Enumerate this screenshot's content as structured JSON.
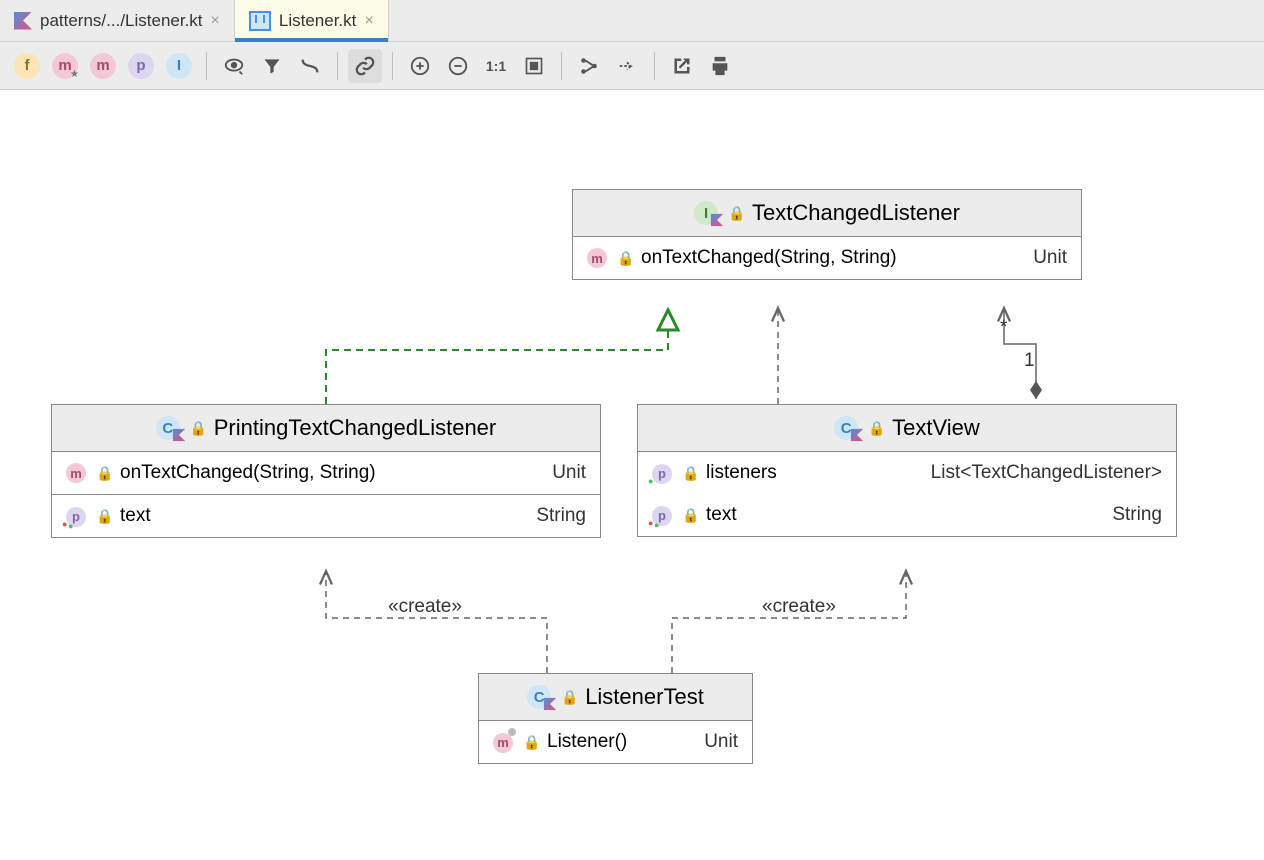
{
  "tabs": [
    {
      "label": "patterns/.../Listener.kt",
      "active": false,
      "icon": "kotlin"
    },
    {
      "label": "Listener.kt",
      "active": true,
      "icon": "diagram"
    }
  ],
  "toolbar": {
    "filter_f": "f",
    "filter_m_star": "m",
    "filter_m": "m",
    "filter_p": "p",
    "filter_i": "I"
  },
  "classes": {
    "textChangedListener": {
      "name": "TextChangedListener",
      "type_icon": "interface",
      "members": [
        {
          "icon": "m",
          "name": "onTextChanged(String, String)",
          "ret": "Unit"
        }
      ]
    },
    "printingTextChangedListener": {
      "name": "PrintingTextChangedListener",
      "type_icon": "class",
      "groups": [
        [
          {
            "icon": "m",
            "name": "onTextChanged(String, String)",
            "ret": "Unit"
          }
        ],
        [
          {
            "icon": "p",
            "name": "text",
            "ret": "String"
          }
        ]
      ]
    },
    "textView": {
      "name": "TextView",
      "type_icon": "class",
      "members": [
        {
          "icon": "p",
          "name": "listeners",
          "ret": "List<TextChangedListener>"
        },
        {
          "icon": "p",
          "name": "text",
          "ret": "String"
        }
      ]
    },
    "listenerTest": {
      "name": "ListenerTest",
      "type_icon": "class",
      "members": [
        {
          "icon": "m_gray",
          "name": "Listener()",
          "ret": "Unit"
        }
      ]
    }
  },
  "connectors": {
    "create1": "«create»",
    "create2": "«create»",
    "mult_star": "*",
    "mult_one": "1"
  }
}
